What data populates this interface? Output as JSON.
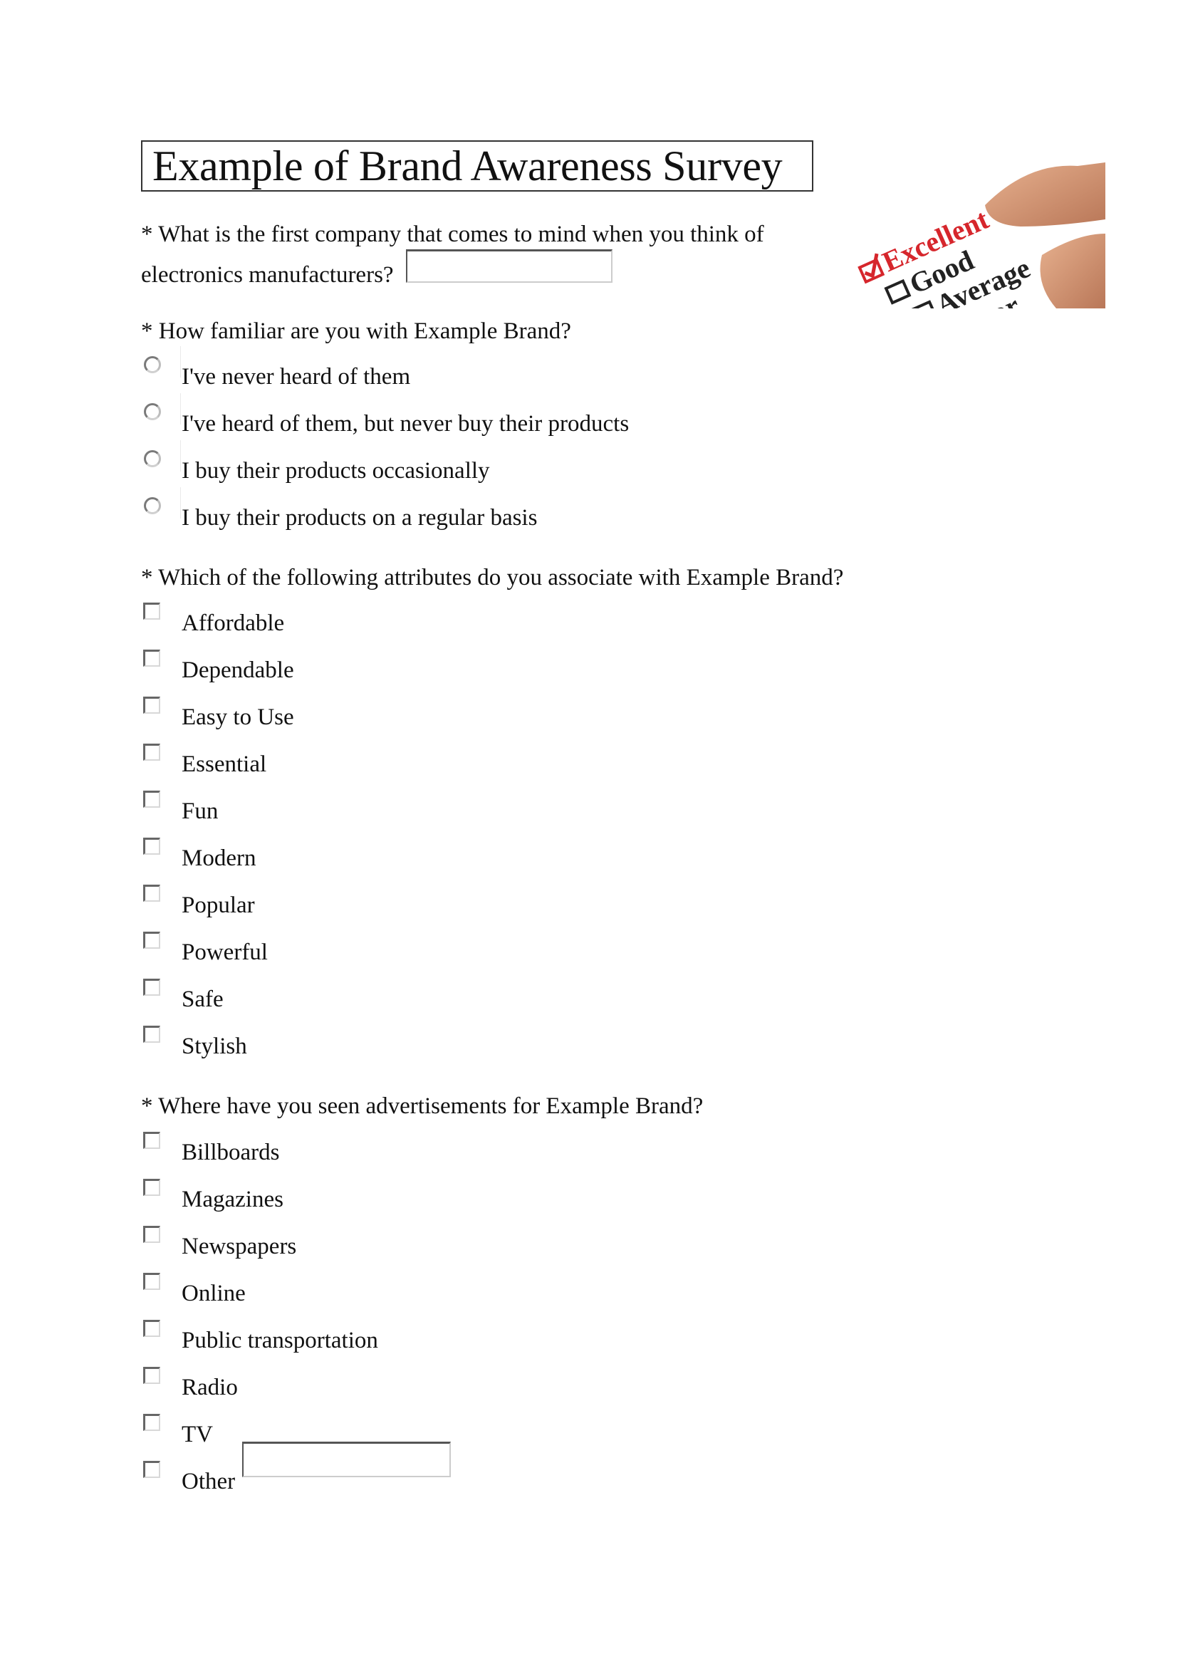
{
  "title": "Example of Brand Awareness Survey",
  "questions": {
    "q1": {
      "line1": "* What is the first company that comes to mind when you think of",
      "line2": "electronics manufacturers?",
      "answer_value": ""
    },
    "q2": {
      "text": "* How familiar are you with Example Brand?",
      "options": [
        "I've never heard of them",
        "I've heard of them, but never buy their products",
        "I buy their products occasionally",
        "I buy their products on a regular basis"
      ]
    },
    "q3": {
      "text": "* Which of the following attributes do you associate with Example Brand?",
      "options": [
        "Affordable",
        "Dependable",
        "Easy to Use",
        "Essential",
        "Fun",
        "Modern",
        "Popular",
        "Powerful",
        "Safe",
        "Stylish"
      ]
    },
    "q4": {
      "text": "* Where have you seen advertisements for Example Brand?",
      "options": [
        "Billboards",
        "Magazines",
        "Newspapers",
        "Online",
        "Public transportation",
        "Radio",
        "TV",
        "Other"
      ],
      "other_value": ""
    }
  },
  "illustration": {
    "icon": "rating-checklist-photo",
    "words": [
      "Excellent",
      "Good",
      "Average",
      "Poor"
    ],
    "accent_color": "#d6262c"
  }
}
